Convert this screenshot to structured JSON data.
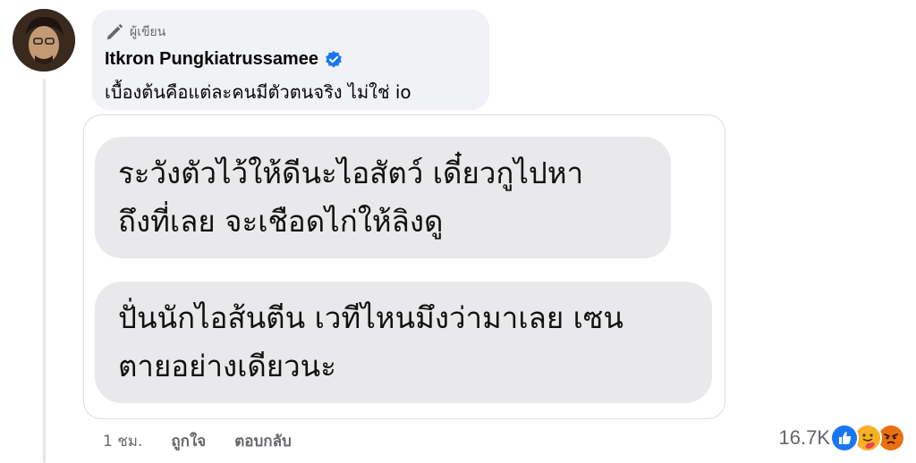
{
  "comment": {
    "author_badge": "ผู้เขียน",
    "author_name": "Itkron Pungkiatrussamee",
    "text": "เบื้องต้นคือแต่ละคนมีตัวตนจริง ไม่ใช่ io"
  },
  "screenshot": {
    "messages": [
      {
        "lines": [
          "ระวังตัวไว้ให้ดีนะไอสัตว์ เดี๋ยวกูไปหา",
          "ถึงที่เลย จะเชือดไก่ให้ลิงดู"
        ]
      },
      {
        "lines": [
          "ปั่นนักไอส้นตีน เวทีไหนมึงว่ามาเลย เซน",
          "ตายอย่างเดียวนะ"
        ]
      }
    ]
  },
  "actions": {
    "time": "1 ชม.",
    "like_label": "ถูกใจ",
    "reply_label": "ตอบกลับ"
  },
  "reactions": {
    "count": "16.7K",
    "icons": [
      "like-icon",
      "care-icon",
      "angry-icon"
    ],
    "colors": {
      "like": "#1877f2",
      "care": "#f7b125",
      "angry": "#e9710f"
    }
  }
}
